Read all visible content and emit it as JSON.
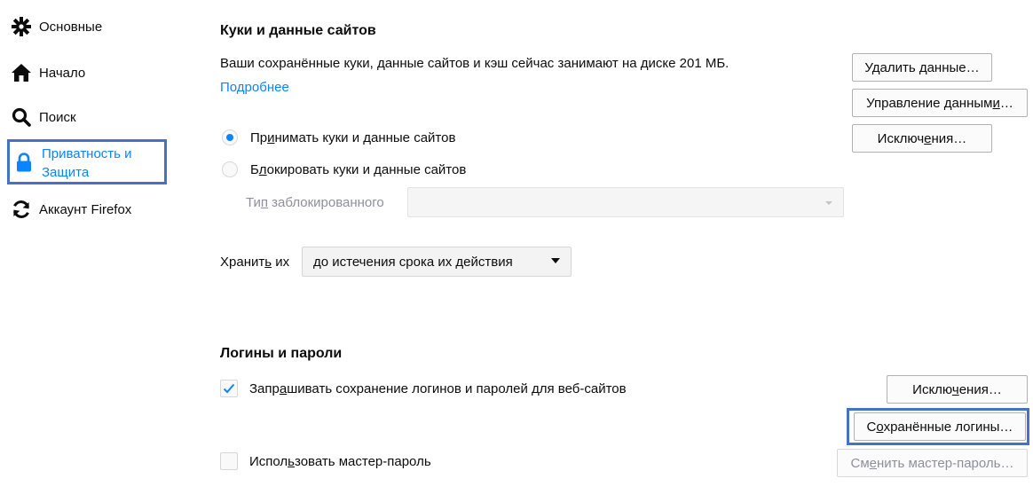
{
  "sidebar": {
    "items": [
      {
        "id": "general",
        "label": "Основные",
        "icon": "gear-icon"
      },
      {
        "id": "home",
        "label": "Начало",
        "icon": "home-icon"
      },
      {
        "id": "search",
        "label": "Поиск",
        "icon": "search-icon"
      },
      {
        "id": "privacy",
        "label_line1": "Приватность и",
        "label_line2": "Защита",
        "icon": "lock-icon"
      },
      {
        "id": "sync",
        "label": "Аккаунт Firefox",
        "icon": "sync-icon"
      }
    ]
  },
  "cookies": {
    "title": "Куки и данные сайтов",
    "description": "Ваши сохранённые куки, данные сайтов и кэш сейчас занимают на диске 201 МБ.",
    "learn_more": "Подробнее",
    "clear_button": "Удалить данные…",
    "manage_button": "Управление данными…",
    "exceptions_button": "Исключения…",
    "accept_label": "Принимать куки и данные сайтов",
    "block_label": "Блокировать куки и данные сайтов",
    "blocked_type_label": "Тип заблокированного",
    "blocked_type_value": "",
    "keep_label": "Хранить их",
    "keep_value": "до истечения срока их действия",
    "accept_selected": true
  },
  "logins": {
    "title": "Логины и пароли",
    "ask_save_label": "Запрашивать сохранение логинов и паролей для веб-сайтов",
    "ask_save_checked": true,
    "exceptions_button": "Исключения…",
    "saved_logins_button": "Сохранённые логины…",
    "master_password_label": "Использовать мастер-пароль",
    "master_password_checked": false,
    "change_master_button": "Сменить мастер-пароль…"
  },
  "colors": {
    "accent": "#0a84ff",
    "highlight": "#4472c4",
    "text": "#0c0c0d"
  }
}
